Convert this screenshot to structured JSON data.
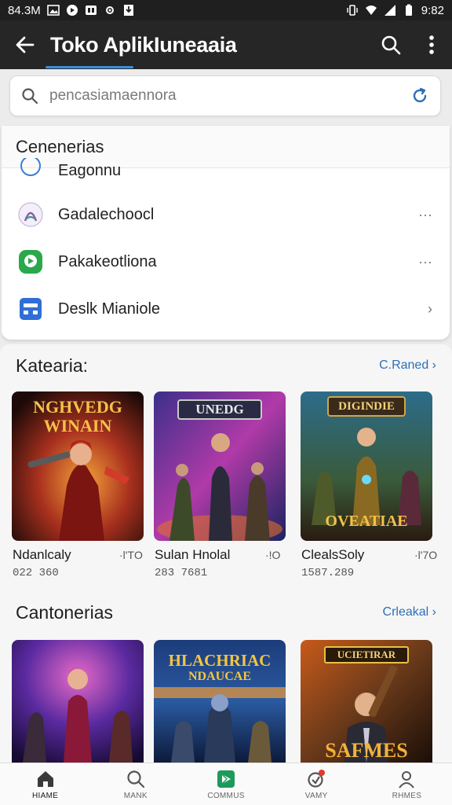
{
  "status_bar": {
    "left_text": "84.3M",
    "time": "9:82"
  },
  "app_bar": {
    "title": "Toko AplikIuneaaia"
  },
  "search": {
    "placeholder": "pencasiamaennora"
  },
  "dropdown": {
    "header": "Cenenerias",
    "items": [
      {
        "label": "Eagonnu",
        "icon": "compass-icon",
        "trail": ""
      },
      {
        "label": "Gadalechoocl",
        "icon": "app-logo-icon",
        "trail": "···"
      },
      {
        "label": "Pakakeotliona",
        "icon": "chat-icon",
        "trail": "···"
      },
      {
        "label": "Deslk Mianiole",
        "icon": "desk-icon",
        "trail": "›"
      }
    ]
  },
  "sections": [
    {
      "title": "Katearia:",
      "link": "C.Raned ›",
      "cards": [
        {
          "art_title": "NGHVEDG WINAIN",
          "name": "Ndanlcaly",
          "rating": "·l'ΤO",
          "size": "022 360"
        },
        {
          "art_title": "UNEDG",
          "name": "Sulan Hnolal",
          "rating": "·!O",
          "size": "283 7681"
        },
        {
          "art_title": "DIGINDIE",
          "art_subtitle": "OVEATIAE",
          "name": "ClealsSoly",
          "rating": "·l'7O",
          "size": "1587.289"
        }
      ]
    },
    {
      "title": "Cantonerias",
      "link": "Crleakal ›",
      "cards": [
        {
          "art_title": ""
        },
        {
          "art_title": "HLACHRIAC",
          "art_subtitle": "NDAUCAE"
        },
        {
          "art_title": "UCIETIRAR",
          "art_subtitle": "SAFMES"
        }
      ]
    }
  ],
  "bottom_nav": [
    {
      "label": "HIAME",
      "icon": "home-icon",
      "active": true
    },
    {
      "label": "MANK",
      "icon": "search-icon",
      "active": false
    },
    {
      "label": "COMMUS",
      "icon": "play-store-icon",
      "active": false
    },
    {
      "label": "VAMY",
      "icon": "update-icon",
      "active": false
    },
    {
      "label": "RHMES",
      "icon": "profile-icon",
      "active": false
    }
  ],
  "colors": {
    "accent": "#2c6fb9",
    "appbar": "#262626",
    "underline": "#3a8fd8"
  }
}
